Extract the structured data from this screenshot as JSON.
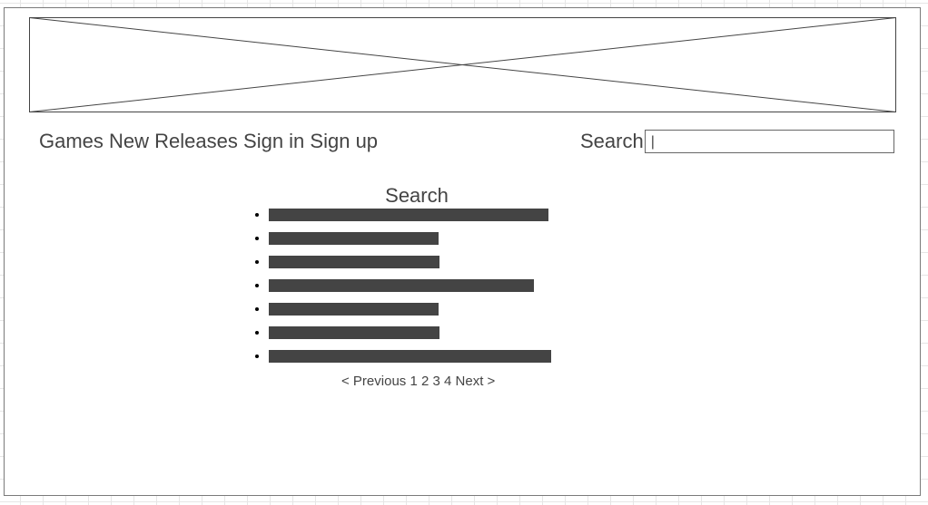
{
  "nav": {
    "links": [
      "Games",
      "New Releases",
      "Sign in",
      "Sign up"
    ]
  },
  "search": {
    "label": "Search",
    "value": "|"
  },
  "results": {
    "title": "Search"
  },
  "pagination": {
    "previous": "< Previous",
    "pages": [
      "1",
      "2",
      "3",
      "4"
    ],
    "next": "Next >"
  },
  "colors": {
    "text": "#444444",
    "placeholder_bar": "#444444",
    "grid": "#e6e6e6",
    "border": "#7a7a7a"
  },
  "icons": {
    "banner": "image-placeholder-icon"
  }
}
